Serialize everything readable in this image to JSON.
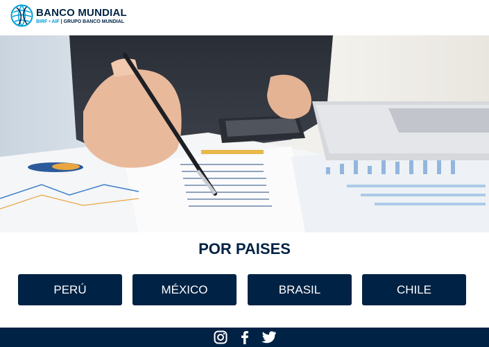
{
  "header": {
    "brand_name": "BANCO MUNDIAL",
    "brand_sub_accent": "BIRF • AIF",
    "brand_sub_separator": "|",
    "brand_sub_group": "GRUPO BANCO MUNDIAL"
  },
  "main": {
    "section_title": "POR PAISES",
    "countries": [
      {
        "label": "PERÚ"
      },
      {
        "label": "MÉXICO"
      },
      {
        "label": "BRASIL"
      },
      {
        "label": "CHILE"
      }
    ]
  },
  "footer": {
    "icons": [
      "instagram-icon",
      "facebook-icon",
      "twitter-icon"
    ]
  },
  "colors": {
    "brand_navy": "#002244",
    "brand_accent": "#009fda"
  }
}
